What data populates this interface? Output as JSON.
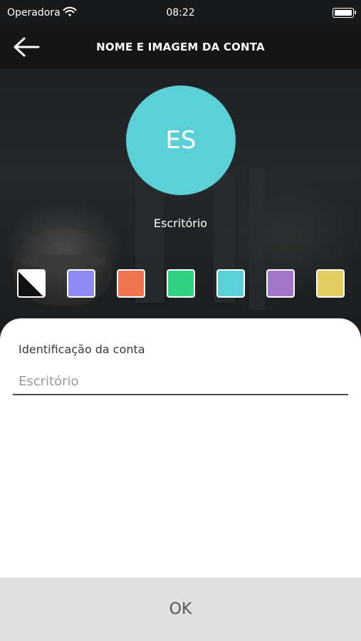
{
  "status_bar": {
    "carrier": "Operadora",
    "time": "08:22"
  },
  "header": {
    "title": "NOME E IMAGEM DA CONTA"
  },
  "avatar": {
    "initials": "ES",
    "name": "Escritório",
    "color": "#5bd1d7"
  },
  "swatches": [
    {
      "name": "none",
      "color": "#ffffff"
    },
    {
      "name": "lavender",
      "color": "#8f8bf2"
    },
    {
      "name": "orange",
      "color": "#ef7550"
    },
    {
      "name": "green",
      "color": "#32d285"
    },
    {
      "name": "cyan",
      "color": "#5bd1d7"
    },
    {
      "name": "purple",
      "color": "#a276c9"
    },
    {
      "name": "yellow",
      "color": "#e4cd62"
    }
  ],
  "form": {
    "label": "Identificação da conta",
    "placeholder": "Escritório",
    "value": ""
  },
  "footer": {
    "ok_label": "OK"
  }
}
